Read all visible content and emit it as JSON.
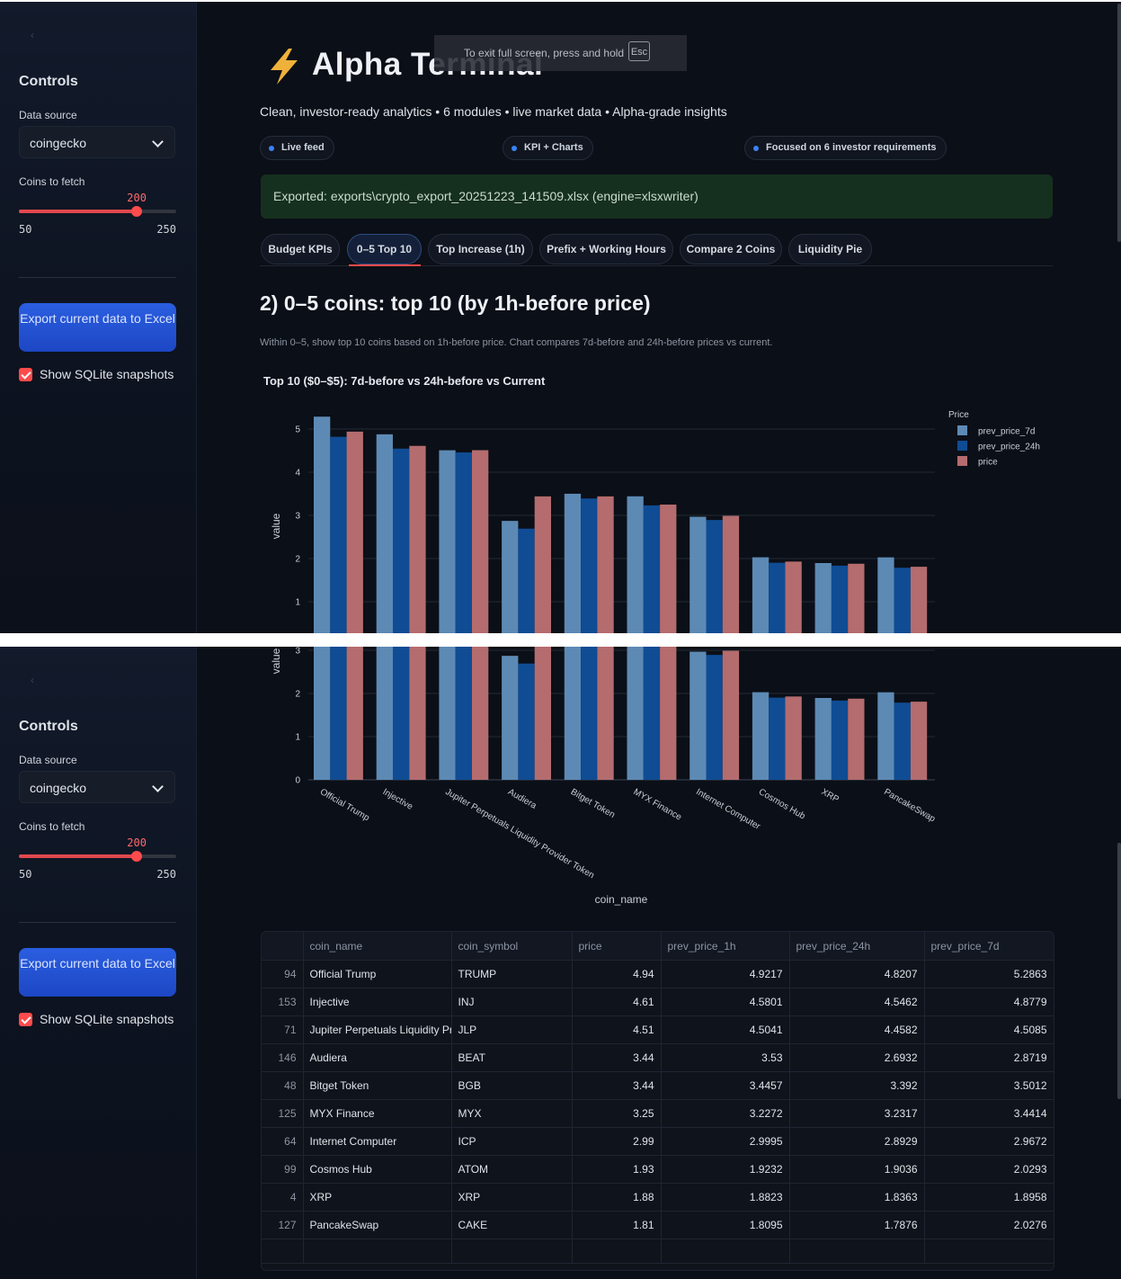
{
  "sidebar": {
    "title": "Controls",
    "data_source_label": "Data source",
    "data_source_value": "coingecko",
    "coins_label": "Coins to fetch",
    "slider_value": "200",
    "slider_min": "50",
    "slider_max": "250",
    "slider_fraction": 0.75,
    "export_button": "Export current data to Excel",
    "show_sqlite_label": "Show SQLite snapshots",
    "show_sqlite_checked": true
  },
  "fullscreen_toast": {
    "text": "To exit full screen, press and hold",
    "key": "Esc"
  },
  "header": {
    "title": "Alpha Terminal",
    "subtitle": "Clean, investor-ready analytics • 6 modules • live market data • Alpha-grade insights",
    "pills": [
      "Live feed",
      "KPI + Charts",
      "Focused on 6 investor requirements"
    ]
  },
  "export_message": "Exported: exports\\crypto_export_20251223_141509.xlsx (engine=xlsxwriter)",
  "tabs": [
    "Budget KPIs",
    "0–5 Top 10",
    "Top Increase (1h)",
    "Prefix + Working Hours",
    "Compare 2 Coins",
    "Liquidity Pie"
  ],
  "active_tab": 1,
  "section": {
    "title": "2) 0–5 coins: top 10 (by 1h-before price)",
    "description": "Within 0–5, show top 10 coins based on 1h-before price. Chart compares 7d-before and 24h-before prices vs current."
  },
  "colors": {
    "prev_price_7d": "#5d8ab4",
    "prev_price_24h": "#0f4c94",
    "price": "#b46c6e"
  },
  "chart_data": {
    "type": "bar",
    "title": "Top 10 ($0–$5): 7d-before vs 24h-before vs Current",
    "xlabel": "coin_name",
    "ylabel": "value",
    "legend_title": "Price",
    "legend_position": "top-right",
    "ylim": [
      0,
      5.3
    ],
    "y_ticks": [
      0,
      1,
      2,
      3,
      4,
      5
    ],
    "grid": true,
    "categories": [
      "Official Trump",
      "Injective",
      "Jupiter Perpetuals Liquidity Provider Token",
      "Audiera",
      "Bitget Token",
      "MYX Finance",
      "Internet Computer",
      "Cosmos Hub",
      "XRP",
      "PancakeSwap"
    ],
    "series": [
      {
        "name": "prev_price_7d",
        "values": [
          5.2863,
          4.8779,
          4.5085,
          2.8719,
          3.5012,
          3.4414,
          2.9672,
          2.0293,
          1.8958,
          2.0276
        ]
      },
      {
        "name": "prev_price_24h",
        "values": [
          4.8207,
          4.5462,
          4.4582,
          2.6932,
          3.392,
          3.2317,
          2.8929,
          1.9036,
          1.8363,
          1.7876
        ]
      },
      {
        "name": "price",
        "values": [
          4.94,
          4.61,
          4.51,
          3.44,
          3.44,
          3.25,
          2.99,
          1.93,
          1.88,
          1.81
        ]
      }
    ]
  },
  "table": {
    "columns": [
      "coin_name",
      "coin_symbol",
      "price",
      "prev_price_1h",
      "prev_price_24h",
      "prev_price_7d"
    ],
    "rows": [
      {
        "idx": "94",
        "cells": [
          "Official Trump",
          "TRUMP",
          "4.94",
          "4.9217",
          "4.8207",
          "5.2863"
        ]
      },
      {
        "idx": "153",
        "cells": [
          "Injective",
          "INJ",
          "4.61",
          "4.5801",
          "4.5462",
          "4.8779"
        ]
      },
      {
        "idx": "71",
        "cells": [
          "Jupiter Perpetuals Liquidity Provider Token",
          "JLP",
          "4.51",
          "4.5041",
          "4.4582",
          "4.5085"
        ]
      },
      {
        "idx": "146",
        "cells": [
          "Audiera",
          "BEAT",
          "3.44",
          "3.53",
          "2.6932",
          "2.8719"
        ]
      },
      {
        "idx": "48",
        "cells": [
          "Bitget Token",
          "BGB",
          "3.44",
          "3.4457",
          "3.392",
          "3.5012"
        ]
      },
      {
        "idx": "125",
        "cells": [
          "MYX Finance",
          "MYX",
          "3.25",
          "3.2272",
          "3.2317",
          "3.4414"
        ]
      },
      {
        "idx": "64",
        "cells": [
          "Internet Computer",
          "ICP",
          "2.99",
          "2.9995",
          "2.8929",
          "2.9672"
        ]
      },
      {
        "idx": "99",
        "cells": [
          "Cosmos Hub",
          "ATOM",
          "1.93",
          "1.9232",
          "1.9036",
          "2.0293"
        ]
      },
      {
        "idx": "4",
        "cells": [
          "XRP",
          "XRP",
          "1.88",
          "1.8823",
          "1.8363",
          "1.8958"
        ]
      },
      {
        "idx": "127",
        "cells": [
          "PancakeSwap",
          "CAKE",
          "1.81",
          "1.8095",
          "1.7876",
          "2.0276"
        ]
      }
    ]
  }
}
